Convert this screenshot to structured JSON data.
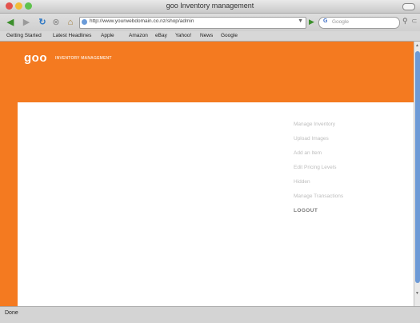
{
  "window": {
    "title": "goo Inventory management"
  },
  "toolbar": {
    "url": "http://www.yourwebdomain.co.nz/shop/admin",
    "search_placeholder": "Google"
  },
  "bookmarks": [
    "Getting Started",
    "Latest Headlines",
    "Apple",
    "Amazon",
    "eBay",
    "Yahoo!",
    "News",
    "Google"
  ],
  "site": {
    "logo": "goo",
    "logo_sub": "INVENTORY MANAGEMENT",
    "accent_color": "#f47a20"
  },
  "menu": [
    "Manage Inventory",
    "Upload Images",
    "Add an Item",
    "Edit Pricing Levels",
    "Hidden",
    "Manage Transactions",
    "LOGOUT"
  ],
  "status": {
    "text": "Done"
  }
}
